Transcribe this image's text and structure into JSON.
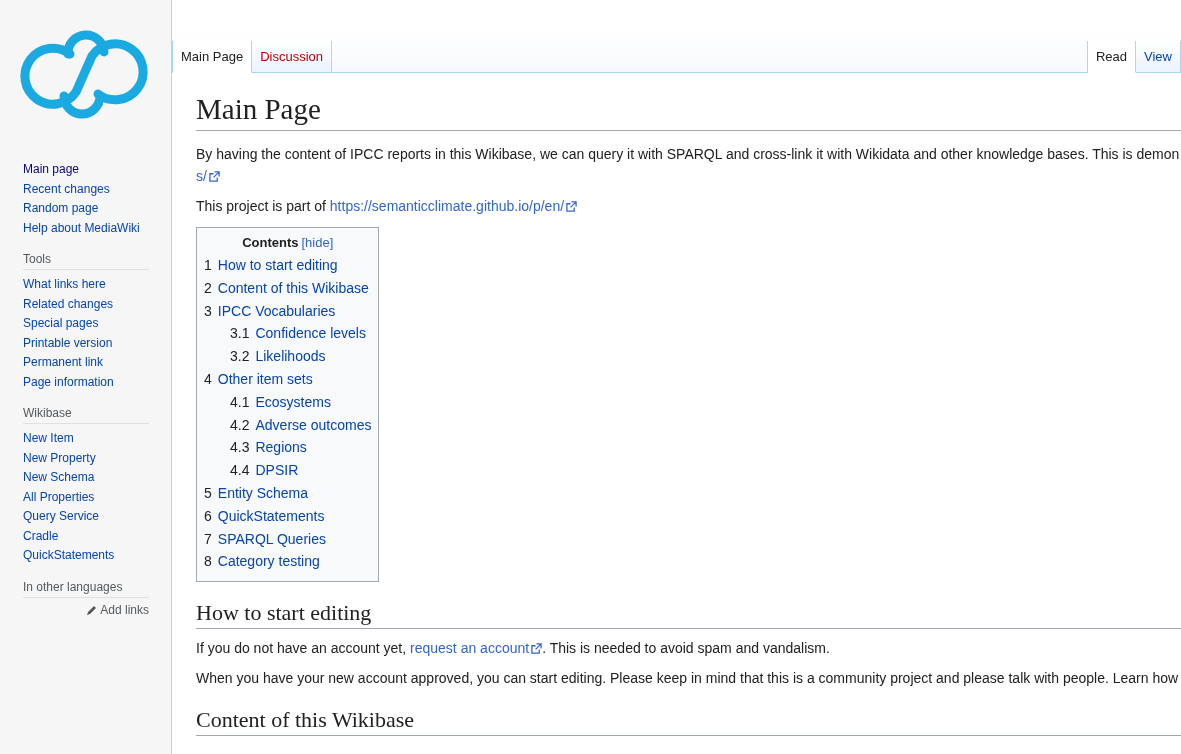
{
  "sidebar": {
    "navigation": [
      {
        "label": "Main page",
        "selected": true
      },
      {
        "label": "Recent changes",
        "selected": false
      },
      {
        "label": "Random page",
        "selected": false
      },
      {
        "label": "Help about MediaWiki",
        "selected": false
      }
    ],
    "portals": [
      {
        "heading": "Tools",
        "items": [
          "What links here",
          "Related changes",
          "Special pages",
          "Printable version",
          "Permanent link",
          "Page information"
        ]
      },
      {
        "heading": "Wikibase",
        "items": [
          "New Item",
          "New Property",
          "New Schema",
          "All Properties",
          "Query Service",
          "Cradle",
          "QuickStatements"
        ]
      }
    ],
    "languages": {
      "heading": "In other languages",
      "action": "Add links"
    }
  },
  "tabs_left": [
    {
      "label": "Main Page",
      "selected": true,
      "kind": "page"
    },
    {
      "label": "Discussion",
      "selected": false,
      "kind": "missing"
    }
  ],
  "tabs_right": [
    {
      "label": "Read",
      "selected": true
    },
    {
      "label": "View",
      "selected": false
    }
  ],
  "page": {
    "title": "Main Page",
    "intro": {
      "text": "By having the content of IPCC reports in this Wikibase, we can query it with SPARQL and cross-link it with Wikidata and other knowledge bases. This is demon",
      "link": "s/"
    },
    "project": {
      "text": "This project is part of ",
      "link": "https://semanticclimate.github.io/p/en/"
    },
    "toc": {
      "title": "Contents",
      "toggle": "[hide]",
      "items": [
        {
          "number": "1",
          "label": "How to start editing"
        },
        {
          "number": "2",
          "label": "Content of this Wikibase"
        },
        {
          "number": "3",
          "label": "IPCC Vocabularies",
          "children": [
            {
              "number": "3.1",
              "label": "Confidence levels"
            },
            {
              "number": "3.2",
              "label": "Likelihoods"
            }
          ]
        },
        {
          "number": "4",
          "label": "Other item sets",
          "children": [
            {
              "number": "4.1",
              "label": "Ecosystems"
            },
            {
              "number": "4.2",
              "label": "Adverse outcomes"
            },
            {
              "number": "4.3",
              "label": "Regions"
            },
            {
              "number": "4.4",
              "label": "DPSIR"
            }
          ]
        },
        {
          "number": "5",
          "label": "Entity Schema"
        },
        {
          "number": "6",
          "label": "QuickStatements"
        },
        {
          "number": "7",
          "label": "SPARQL Queries"
        },
        {
          "number": "8",
          "label": "Category testing"
        }
      ]
    },
    "sections": [
      {
        "heading": "How to start editing",
        "paragraphs": [
          {
            "before": "If you do not have an account yet, ",
            "link": "request an account",
            "after": ". This is needed to avoid spam and vandalism."
          },
          {
            "before": "When you have your new account approved, you can start editing. Please keep in mind that this is a community project and please talk with people. Learn how"
          }
        ]
      },
      {
        "heading": "Content of this Wikibase"
      }
    ]
  }
}
